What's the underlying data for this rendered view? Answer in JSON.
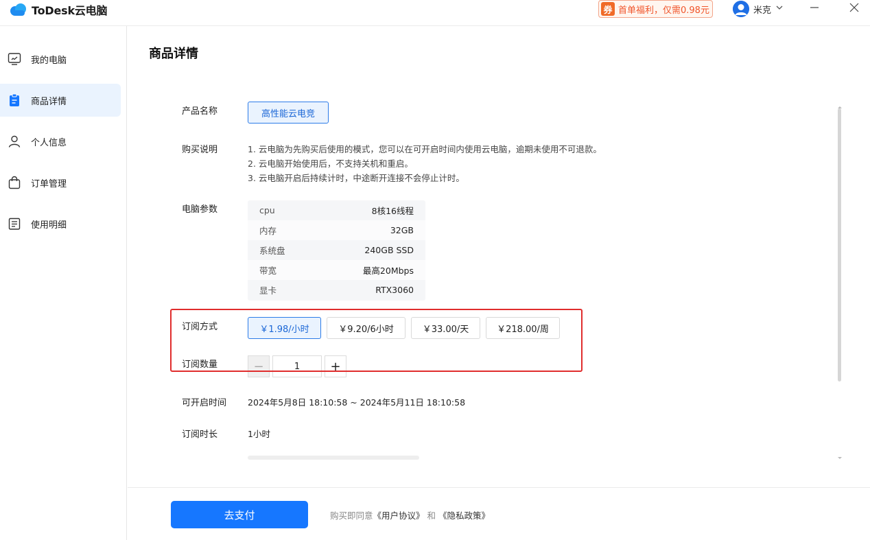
{
  "app": {
    "name": "ToDesk云电脑",
    "promo_badge": "券",
    "promo_text": "首单福利，仅需0.98元",
    "user_name": "米克"
  },
  "sidebar": {
    "items": [
      {
        "label": "我的电脑",
        "icon": "monitor-icon",
        "active": false
      },
      {
        "label": "商品详情",
        "icon": "clipboard-icon",
        "active": true
      },
      {
        "label": "个人信息",
        "icon": "user-icon",
        "active": false
      },
      {
        "label": "订单管理",
        "icon": "bag-icon",
        "active": false
      },
      {
        "label": "使用明细",
        "icon": "receipt-icon",
        "active": false
      }
    ]
  },
  "main": {
    "title": "商品详情",
    "product_name_label": "产品名称",
    "product_name": "高性能云电竞",
    "purchase_desc_label": "购买说明",
    "purchase_desc": [
      "1. 云电脑为先购买后使用的模式，您可以在可开启时间内使用云电脑，逾期未使用不可退款。",
      "2. 云电脑开始使用后，不支持关机和重启。",
      "3. 云电脑开启后持续计时，中途断开连接不会停止计时。"
    ],
    "params_label": "电脑参数",
    "params": [
      {
        "key": "cpu",
        "value": "8核16线程"
      },
      {
        "key": "内存",
        "value": "32GB"
      },
      {
        "key": "系统盘",
        "value": "240GB SSD"
      },
      {
        "key": "带宽",
        "value": "最高20Mbps"
      },
      {
        "key": "显卡",
        "value": "RTX3060"
      }
    ],
    "subscription_label": "订阅方式",
    "subscription_options": [
      {
        "label": "￥1.98/小时",
        "selected": true
      },
      {
        "label": "￥9.20/6小时",
        "selected": false
      },
      {
        "label": "￥33.00/天",
        "selected": false
      },
      {
        "label": "￥218.00/周",
        "selected": false
      }
    ],
    "quantity_label": "订阅数量",
    "quantity_minus": "−",
    "quantity_value": "1",
    "quantity_plus": "+",
    "open_time_label": "可开启时间",
    "open_time_value": "2024年5月8日 18:10:58 ~ 2024年5月11日 18:10:58",
    "duration_label": "订阅时长",
    "duration_value": "1小时"
  },
  "footer": {
    "pay_button": "去支付",
    "agree_prefix": "购买即同意",
    "user_agreement": "《用户协议》",
    "and": "和",
    "privacy_policy": "《隐私政策》"
  },
  "colors": {
    "accent": "#1677ff",
    "selected_bg": "#eaf3fe",
    "promo": "#f06a27",
    "highlight": "#e02c2c"
  }
}
